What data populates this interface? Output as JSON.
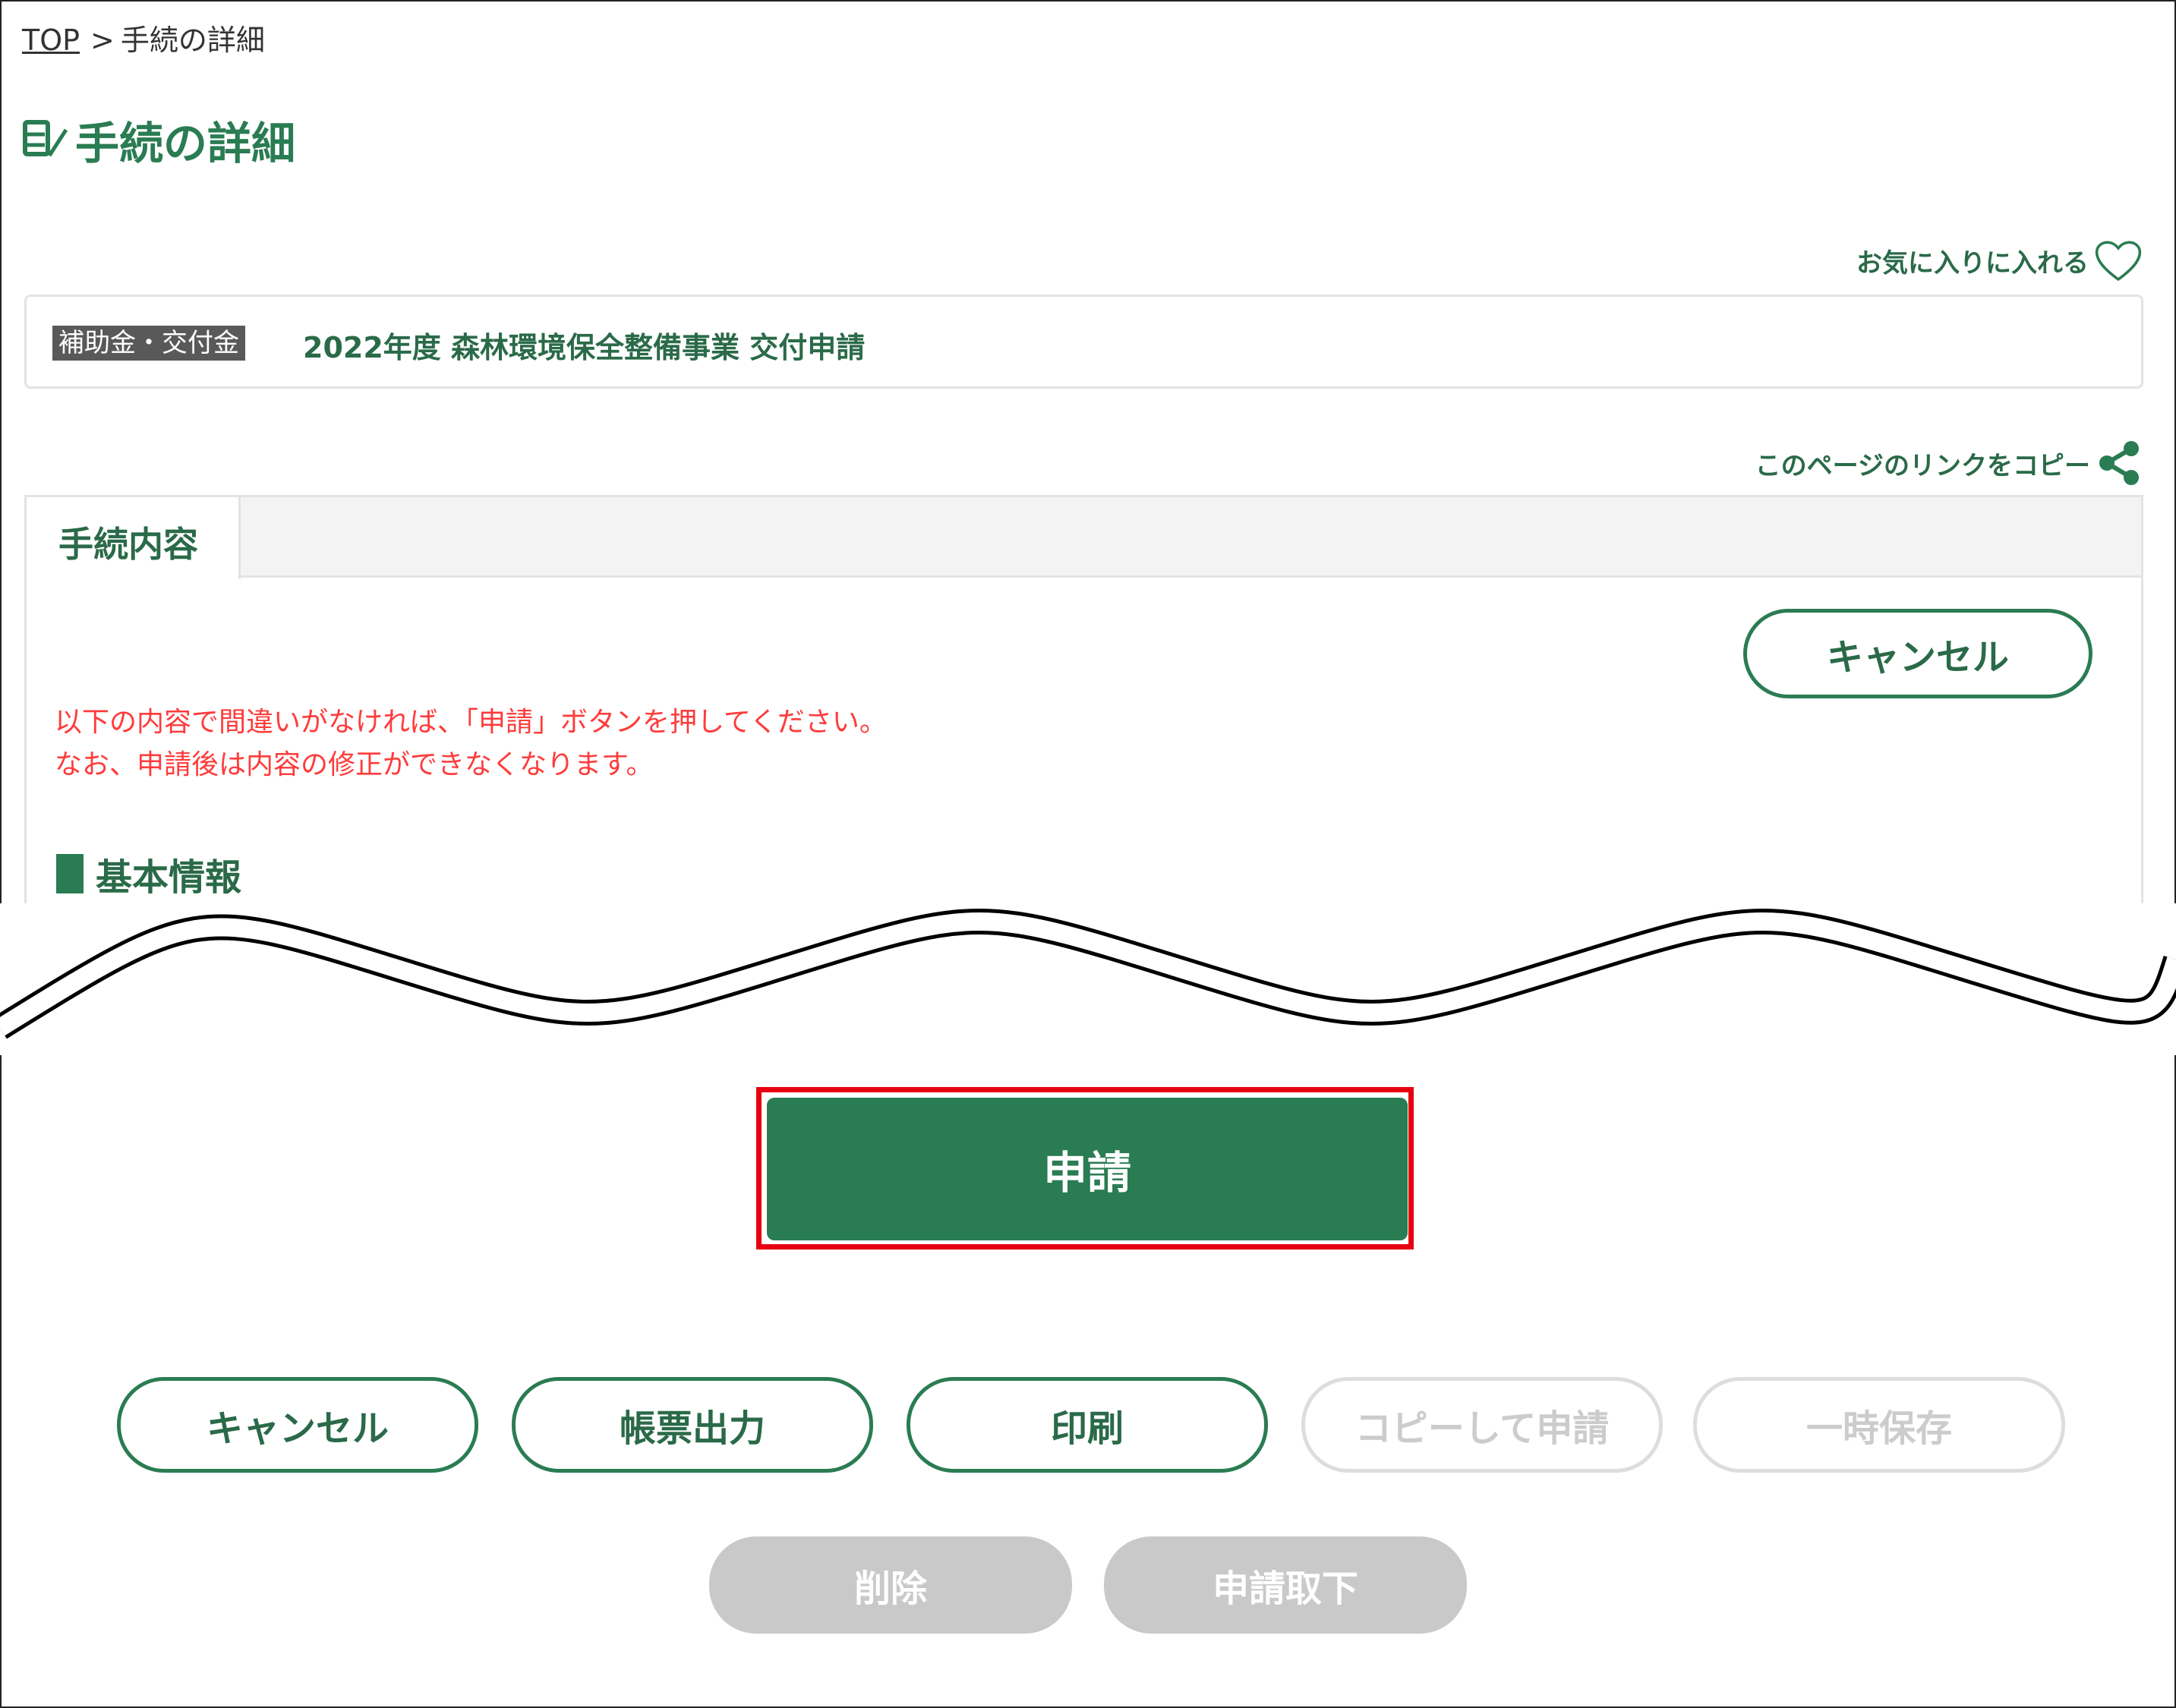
{
  "breadcrumb": {
    "top_link": "TOP",
    "separator": ">",
    "current": "手続の詳細"
  },
  "page": {
    "title": "手続の詳細",
    "title_icon": "form-pen-icon"
  },
  "favorite": {
    "label": "お気に入りに入れる",
    "icon": "heart-outline-icon"
  },
  "procedure": {
    "category_badge": "補助金・交付金",
    "name": "2022年度 森林環境保全整備事業 交付申請"
  },
  "copy_link": {
    "label": "このページのリンクをコピー",
    "icon": "share-icon"
  },
  "tabs": [
    {
      "label": "手続内容",
      "active": true
    }
  ],
  "panel": {
    "cancel_label": "キャンセル",
    "notice_line1": "以下の内容で間違いがなければ、「申請」ボタンを押してください。",
    "notice_line2": "なお、申請後は内容の修正ができなくなります。",
    "section_title": "基本情報"
  },
  "submit": {
    "label": "申請"
  },
  "actions": {
    "cancel": "キャンセル",
    "form_output": "帳票出力",
    "print": "印刷",
    "copy_apply": "コピーして申請",
    "temp_save": "一時保存",
    "delete": "削除",
    "withdraw": "申請取下"
  },
  "colors": {
    "brand_green": "#2a7c52",
    "notice_red": "#ff3b3b",
    "highlight_red": "#e60012",
    "disabled_grey": "#c9c9c9",
    "badge_grey": "#595959"
  }
}
